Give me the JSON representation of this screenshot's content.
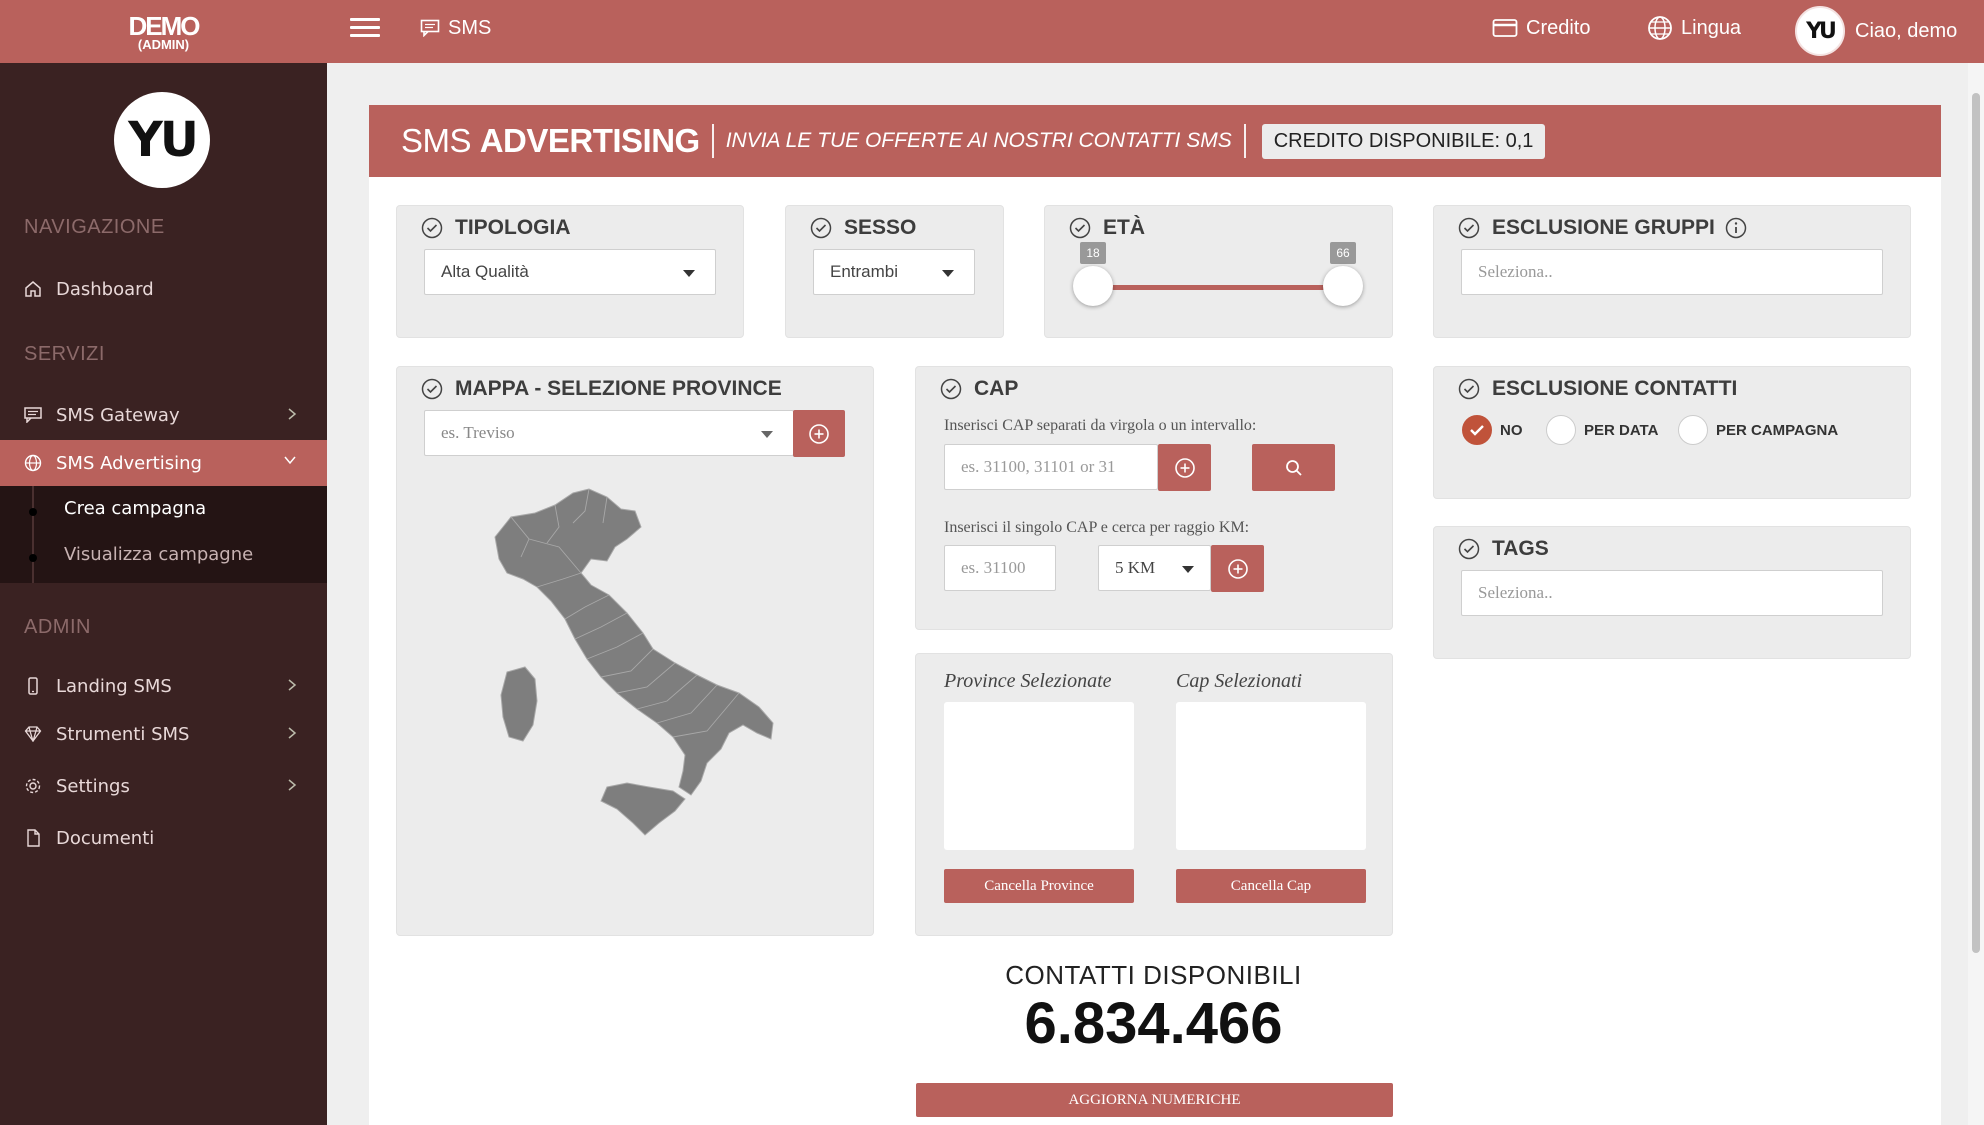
{
  "brand": {
    "name": "DEMO",
    "role": "(ADMIN)",
    "logo_text": "YU"
  },
  "topbar": {
    "sms_label": "SMS",
    "credit_label": "Credito",
    "language_label": "Lingua",
    "user_greeting": "Ciao, demo"
  },
  "sidebar": {
    "sections": {
      "navigation": "NAVIGAZIONE",
      "services": "SERVIZI",
      "admin": "ADMIN"
    },
    "items": {
      "dashboard": "Dashboard",
      "sms_gateway": "SMS Gateway",
      "sms_advertising": "SMS Advertising",
      "crea_campagna": "Crea campagna",
      "visualizza_campagne": "Visualizza campagne",
      "landing_sms": "Landing SMS",
      "strumenti_sms": "Strumenti SMS",
      "settings": "Settings",
      "documenti": "Documenti"
    }
  },
  "header": {
    "title_light": "SMS",
    "title_bold": "ADVERTISING",
    "subtitle": "INVIA LE TUE OFFERTE AI NOSTRI CONTATTI SMS",
    "credit": "CREDITO DISPONIBILE: 0,1"
  },
  "filters": {
    "tipologia": {
      "title": "TIPOLOGIA",
      "value": "Alta Qualità"
    },
    "sesso": {
      "title": "SESSO",
      "value": "Entrambi"
    },
    "eta": {
      "title": "ETÀ",
      "min": "18",
      "max": "66"
    },
    "esclusione_gruppi": {
      "title": "ESCLUSIONE GRUPPI",
      "placeholder": "Seleziona.."
    },
    "mappa": {
      "title": "MAPPA - SELEZIONE PROVINCE",
      "placeholder": "es. Treviso"
    },
    "cap": {
      "title": "CAP",
      "hint1": "Inserisci CAP separati da virgola o un intervallo:",
      "placeholder1": "es. 31100, 31101 or 31",
      "hint2": "Inserisci il singolo CAP e cerca per raggio KM:",
      "placeholder2": "es. 31100",
      "radius": "5 KM"
    },
    "esclusione_contatti": {
      "title": "ESCLUSIONE CONTATTI",
      "options": [
        "NO",
        "PER DATA",
        "PER CAMPAGNA"
      ],
      "selected": "NO"
    },
    "tags": {
      "title": "TAGS",
      "placeholder": "Seleziona.."
    }
  },
  "selections": {
    "province_title": "Province Selezionate",
    "cap_title": "Cap Selezionati",
    "clear_province": "Cancella Province",
    "clear_cap": "Cancella Cap"
  },
  "contacts": {
    "label": "CONTATTI DISPONIBILI",
    "value": "6.834.466",
    "update_button": "AGGIORNA NUMERICHE"
  },
  "colors": {
    "accent": "#b9615c",
    "sidebar": "#3a2222",
    "radio_on": "#c0533a"
  }
}
